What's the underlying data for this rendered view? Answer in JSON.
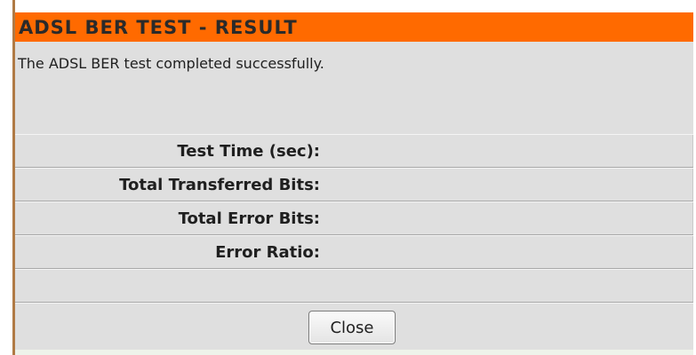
{
  "title": "ADSL BER TEST - RESULT",
  "message": "The ADSL BER test completed successfully.",
  "results": [
    {
      "label": "Test Time (sec):",
      "value": ""
    },
    {
      "label": "Total Transferred Bits:",
      "value": ""
    },
    {
      "label": "Total Error Bits:",
      "value": ""
    },
    {
      "label": "Error Ratio:",
      "value": ""
    },
    {
      "label": "",
      "value": ""
    }
  ],
  "buttons": {
    "close_label": "Close"
  },
  "colors": {
    "title_bar": "#ff6a00",
    "panel_bg": "#dfdfdf",
    "left_border": "#b07a45"
  }
}
